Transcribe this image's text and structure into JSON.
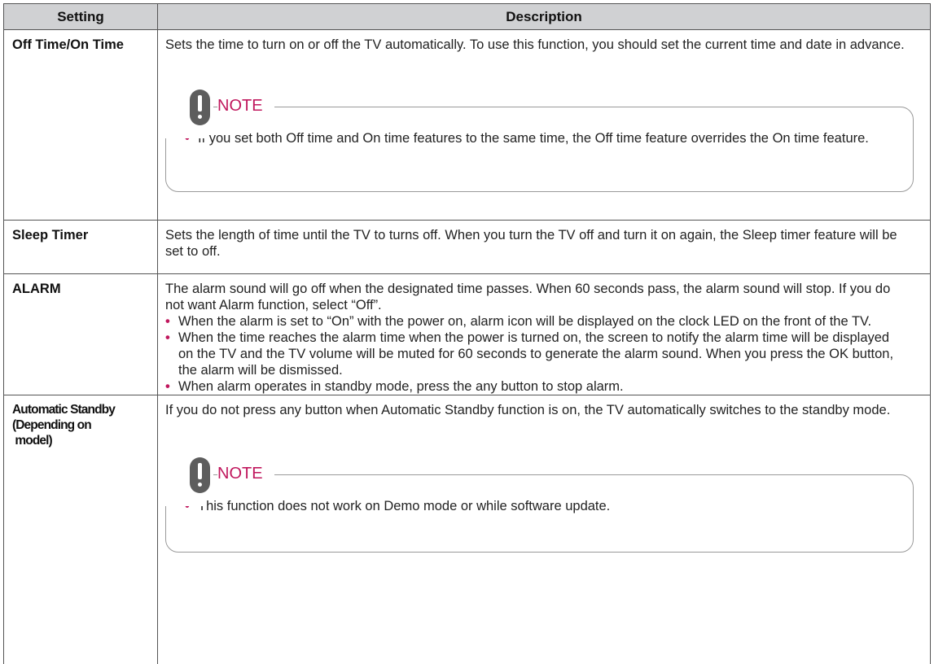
{
  "header": {
    "setting": "Setting",
    "description": "Description"
  },
  "rows": [
    {
      "setting": "Off Time/On Time",
      "description": "Sets the time to turn on or off the TV automatically. To use this function, you should set the current time and date in advance.",
      "note": {
        "title": "NOTE",
        "items": [
          "If you set both Off time and On time features to the same time, the Off time feature overrides the On time feature."
        ]
      }
    },
    {
      "setting": "Sleep Timer",
      "description": "Sets the length of time until the TV to turns off. When you turn the TV off and turn it on again, the Sleep timer feature will be set to off."
    },
    {
      "setting": "ALARM",
      "description": "The alarm sound will go off when the designated time passes. When 60 seconds pass, the alarm sound will stop. If you do not want Alarm function, select “Off”.",
      "bullets": [
        "When the alarm is set to “On” with the power on, alarm icon will be displayed on the clock LED on the front of the TV.",
        "When the time reaches the alarm time when the power is turned on, the screen to notify the alarm time will be displayed on the TV and the TV volume will be muted for 60 seconds to generate the alarm sound. When you press the OK button, the alarm will be dismissed.",
        "When alarm operates in standby mode, press the any button to stop alarm."
      ]
    },
    {
      "setting_lines": [
        "Automatic Standby",
        "(Depending on",
        " model)"
      ],
      "description": "If you do not press any button when Automatic Standby function is on, the TV automatically switches to the standby mode.",
      "note": {
        "title": "NOTE",
        "items": [
          "This function does not work on Demo mode or while software update."
        ]
      }
    }
  ],
  "colors": {
    "accent": "#c0175d",
    "header_bg": "#d0d1d3",
    "note_icon": "#5d5d5d"
  },
  "bullet_glyph": "•"
}
